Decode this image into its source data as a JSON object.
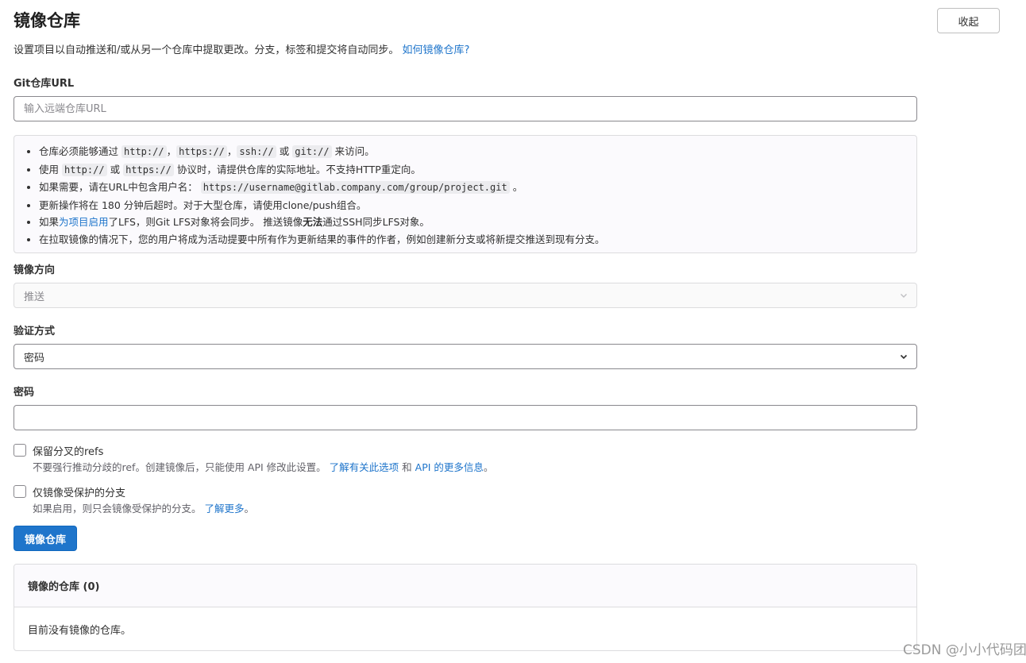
{
  "header": {
    "title": "镜像仓库",
    "collapse_label": "收起",
    "description": "设置项目以自动推送和/或从另一个仓库中提取更改。分支，标签和提交将自动同步。",
    "description_link": "如何镜像仓库?"
  },
  "git_url": {
    "label": "Git仓库URL",
    "placeholder": "输入远端仓库URL",
    "value": ""
  },
  "info": {
    "item1": {
      "prefix": "仓库必须能够通过",
      "code1": "http://",
      "sep1": "，",
      "code2": "https://",
      "sep2": "，",
      "code3": "ssh://",
      "or": "或",
      "code4": "git://",
      "suffix": "来访问。"
    },
    "item2": {
      "prefix": "使用",
      "code1": "http://",
      "or": "或",
      "code2": "https://",
      "suffix": "协议时，请提供仓库的实际地址。不支持HTTP重定向。"
    },
    "item3": {
      "prefix": "如果需要，请在URL中包含用户名：",
      "code": "https://username@gitlab.company.com/group/project.git",
      "suffix": "。"
    },
    "item4": {
      "text": "更新操作将在 180 分钟后超时。对于大型仓库，请使用clone/push组合。"
    },
    "item5": {
      "prefix": "如果",
      "link": "为项目启用",
      "middle": "了LFS，则Git LFS对象将会同步。 推送镜像",
      "bold": "无法",
      "suffix": "通过SSH同步LFS对象。"
    },
    "item6": {
      "text": "在拉取镜像的情况下，您的用户将成为活动提要中所有作为更新结果的事件的作者，例如创建新分支或将新提交推送到现有分支。"
    }
  },
  "direction": {
    "label": "镜像方向",
    "value": "推送"
  },
  "auth": {
    "label": "验证方式",
    "value": "密码"
  },
  "password": {
    "label": "密码",
    "value": ""
  },
  "keep_refs": {
    "label": "保留分叉的refs",
    "checked": false,
    "help_prefix": "不要强行推动分歧的ref。创建镜像后，只能使用 API 修改此设置。",
    "help_link1": "了解有关此选项",
    "help_and": "和",
    "help_link2": "API 的更多信息",
    "help_suffix": "。"
  },
  "protected_only": {
    "label": "仅镜像受保护的分支",
    "checked": false,
    "help_prefix": "如果启用，则只会镜像受保护的分支。",
    "help_link": "了解更多",
    "help_suffix": "。"
  },
  "submit_label": "镜像仓库",
  "mirrored_repos": {
    "header": "镜像的仓库 (0)",
    "empty_text": "目前没有镜像的仓库。"
  },
  "watermark": "CSDN @小小代码团",
  "colors": {
    "primary": "#1f75cb",
    "link": "#1f75cb",
    "text": "#303030",
    "border": "#dcdcde"
  }
}
